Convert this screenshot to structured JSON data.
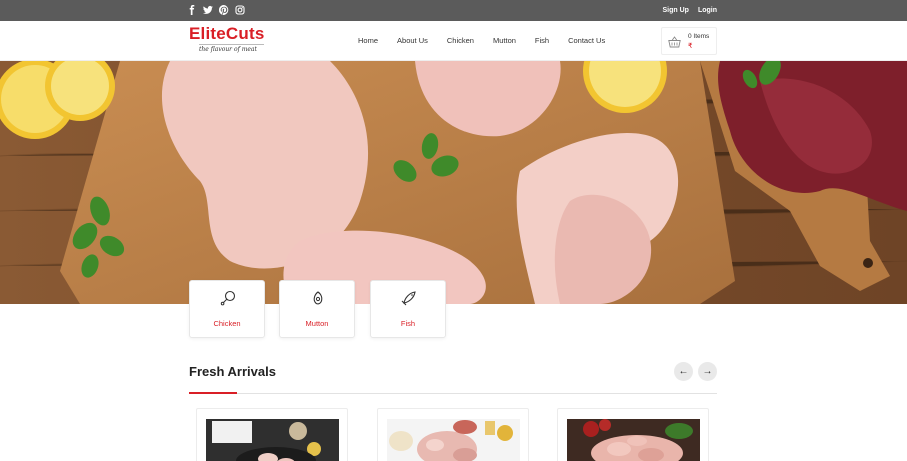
{
  "topbar": {
    "social_icons": [
      "facebook-icon",
      "twitter-icon",
      "pinterest-icon",
      "instagram-icon"
    ],
    "signup_label": "Sign Up",
    "login_label": "Login"
  },
  "header": {
    "logo_text": "EliteCuts",
    "logo_tagline": "the flavour of meat",
    "nav": [
      "Home",
      "About Us",
      "Chicken",
      "Mutton",
      "Fish",
      "Contact Us"
    ],
    "cart": {
      "icon": "basket-icon",
      "items_text": "0 Items",
      "price_text": "₹"
    }
  },
  "hero": {
    "description_icon": "hero-banner"
  },
  "categories": [
    {
      "label": "Chicken",
      "icon": "drumstick-icon"
    },
    {
      "label": "Mutton",
      "icon": "mutton-icon"
    },
    {
      "label": "Fish",
      "icon": "fish-icon"
    }
  ],
  "fresh_arrivals": {
    "title": "Fresh Arrivals",
    "prev_label": "←",
    "next_label": "→"
  },
  "colors": {
    "brand_red": "#d91f26",
    "topbar_bg": "#5b5b5b"
  }
}
